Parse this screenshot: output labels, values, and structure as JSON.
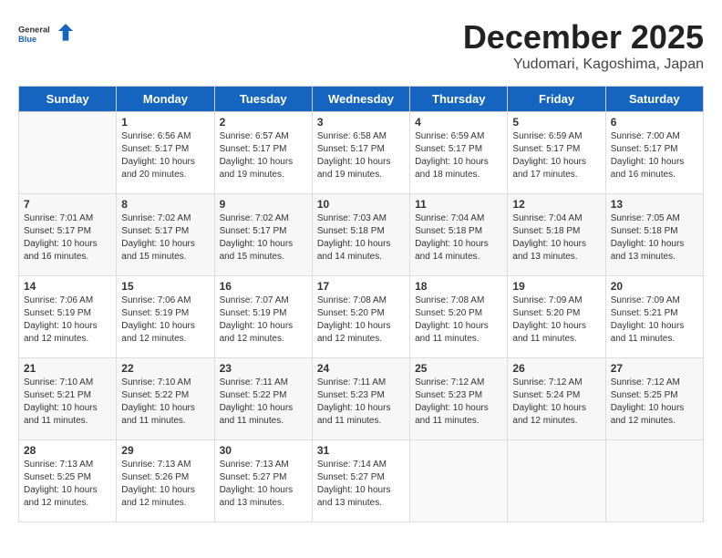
{
  "logo": {
    "general": "General",
    "blue": "Blue"
  },
  "title": "December 2025",
  "subtitle": "Yudomari, Kagoshima, Japan",
  "weekdays": [
    "Sunday",
    "Monday",
    "Tuesday",
    "Wednesday",
    "Thursday",
    "Friday",
    "Saturday"
  ],
  "weeks": [
    [
      {
        "day": "",
        "info": ""
      },
      {
        "day": "1",
        "info": "Sunrise: 6:56 AM\nSunset: 5:17 PM\nDaylight: 10 hours\nand 20 minutes."
      },
      {
        "day": "2",
        "info": "Sunrise: 6:57 AM\nSunset: 5:17 PM\nDaylight: 10 hours\nand 19 minutes."
      },
      {
        "day": "3",
        "info": "Sunrise: 6:58 AM\nSunset: 5:17 PM\nDaylight: 10 hours\nand 19 minutes."
      },
      {
        "day": "4",
        "info": "Sunrise: 6:59 AM\nSunset: 5:17 PM\nDaylight: 10 hours\nand 18 minutes."
      },
      {
        "day": "5",
        "info": "Sunrise: 6:59 AM\nSunset: 5:17 PM\nDaylight: 10 hours\nand 17 minutes."
      },
      {
        "day": "6",
        "info": "Sunrise: 7:00 AM\nSunset: 5:17 PM\nDaylight: 10 hours\nand 16 minutes."
      }
    ],
    [
      {
        "day": "7",
        "info": "Sunrise: 7:01 AM\nSunset: 5:17 PM\nDaylight: 10 hours\nand 16 minutes."
      },
      {
        "day": "8",
        "info": "Sunrise: 7:02 AM\nSunset: 5:17 PM\nDaylight: 10 hours\nand 15 minutes."
      },
      {
        "day": "9",
        "info": "Sunrise: 7:02 AM\nSunset: 5:17 PM\nDaylight: 10 hours\nand 15 minutes."
      },
      {
        "day": "10",
        "info": "Sunrise: 7:03 AM\nSunset: 5:18 PM\nDaylight: 10 hours\nand 14 minutes."
      },
      {
        "day": "11",
        "info": "Sunrise: 7:04 AM\nSunset: 5:18 PM\nDaylight: 10 hours\nand 14 minutes."
      },
      {
        "day": "12",
        "info": "Sunrise: 7:04 AM\nSunset: 5:18 PM\nDaylight: 10 hours\nand 13 minutes."
      },
      {
        "day": "13",
        "info": "Sunrise: 7:05 AM\nSunset: 5:18 PM\nDaylight: 10 hours\nand 13 minutes."
      }
    ],
    [
      {
        "day": "14",
        "info": "Sunrise: 7:06 AM\nSunset: 5:19 PM\nDaylight: 10 hours\nand 12 minutes."
      },
      {
        "day": "15",
        "info": "Sunrise: 7:06 AM\nSunset: 5:19 PM\nDaylight: 10 hours\nand 12 minutes."
      },
      {
        "day": "16",
        "info": "Sunrise: 7:07 AM\nSunset: 5:19 PM\nDaylight: 10 hours\nand 12 minutes."
      },
      {
        "day": "17",
        "info": "Sunrise: 7:08 AM\nSunset: 5:20 PM\nDaylight: 10 hours\nand 12 minutes."
      },
      {
        "day": "18",
        "info": "Sunrise: 7:08 AM\nSunset: 5:20 PM\nDaylight: 10 hours\nand 11 minutes."
      },
      {
        "day": "19",
        "info": "Sunrise: 7:09 AM\nSunset: 5:20 PM\nDaylight: 10 hours\nand 11 minutes."
      },
      {
        "day": "20",
        "info": "Sunrise: 7:09 AM\nSunset: 5:21 PM\nDaylight: 10 hours\nand 11 minutes."
      }
    ],
    [
      {
        "day": "21",
        "info": "Sunrise: 7:10 AM\nSunset: 5:21 PM\nDaylight: 10 hours\nand 11 minutes."
      },
      {
        "day": "22",
        "info": "Sunrise: 7:10 AM\nSunset: 5:22 PM\nDaylight: 10 hours\nand 11 minutes."
      },
      {
        "day": "23",
        "info": "Sunrise: 7:11 AM\nSunset: 5:22 PM\nDaylight: 10 hours\nand 11 minutes."
      },
      {
        "day": "24",
        "info": "Sunrise: 7:11 AM\nSunset: 5:23 PM\nDaylight: 10 hours\nand 11 minutes."
      },
      {
        "day": "25",
        "info": "Sunrise: 7:12 AM\nSunset: 5:23 PM\nDaylight: 10 hours\nand 11 minutes."
      },
      {
        "day": "26",
        "info": "Sunrise: 7:12 AM\nSunset: 5:24 PM\nDaylight: 10 hours\nand 12 minutes."
      },
      {
        "day": "27",
        "info": "Sunrise: 7:12 AM\nSunset: 5:25 PM\nDaylight: 10 hours\nand 12 minutes."
      }
    ],
    [
      {
        "day": "28",
        "info": "Sunrise: 7:13 AM\nSunset: 5:25 PM\nDaylight: 10 hours\nand 12 minutes."
      },
      {
        "day": "29",
        "info": "Sunrise: 7:13 AM\nSunset: 5:26 PM\nDaylight: 10 hours\nand 12 minutes."
      },
      {
        "day": "30",
        "info": "Sunrise: 7:13 AM\nSunset: 5:27 PM\nDaylight: 10 hours\nand 13 minutes."
      },
      {
        "day": "31",
        "info": "Sunrise: 7:14 AM\nSunset: 5:27 PM\nDaylight: 10 hours\nand 13 minutes."
      },
      {
        "day": "",
        "info": ""
      },
      {
        "day": "",
        "info": ""
      },
      {
        "day": "",
        "info": ""
      }
    ]
  ]
}
